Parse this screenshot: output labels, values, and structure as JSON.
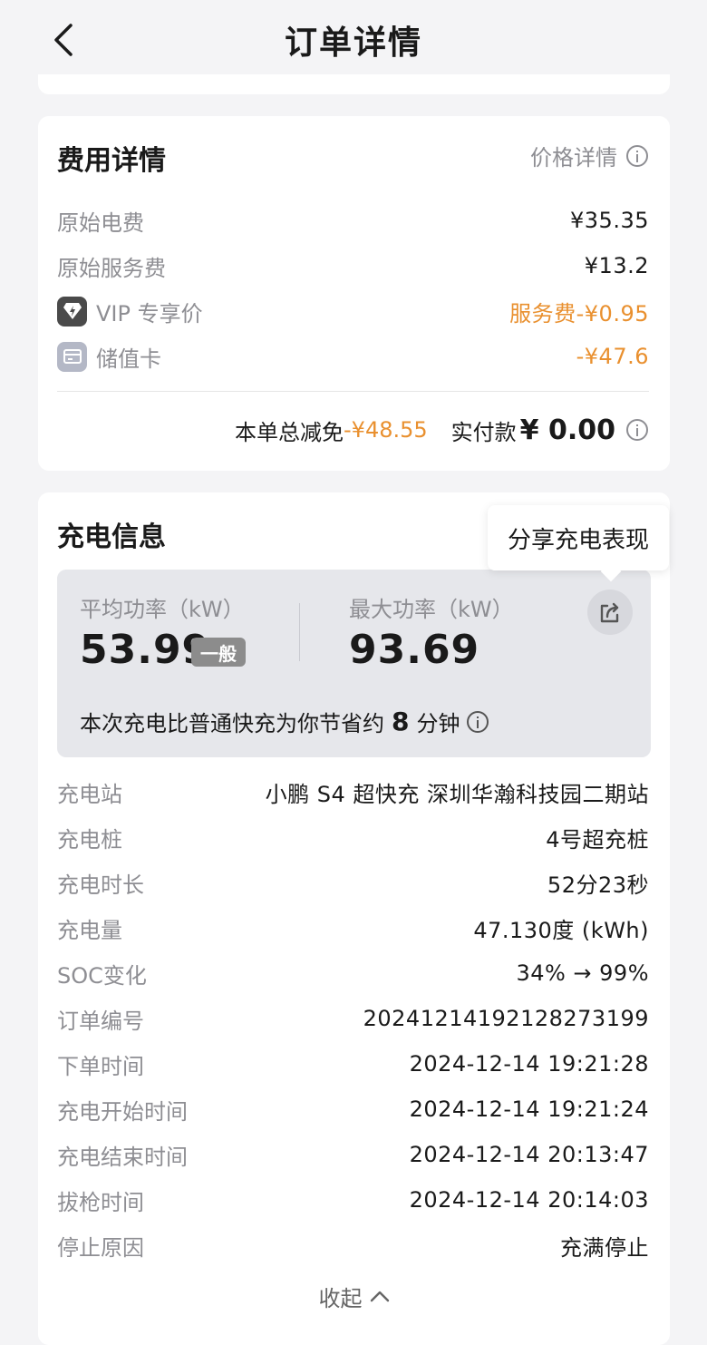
{
  "nav": {
    "title": "订单详情"
  },
  "fee": {
    "title": "费用详情",
    "price_detail_link": "价格详情",
    "rows": [
      {
        "label": "原始电费",
        "value": "¥35.35"
      },
      {
        "label": "原始服务费",
        "value": "¥13.2"
      },
      {
        "label": "VIP 专享价",
        "value": "服务费-¥0.95",
        "icon": "vip-diamond-icon",
        "accent": "#e9902f"
      },
      {
        "label": "储值卡",
        "value": "-¥47.6",
        "icon": "card-icon",
        "accent": "#e9902f"
      }
    ],
    "total_discount_label": "本单总减免",
    "total_discount_value": "-¥48.55",
    "paid_label": "实付款",
    "paid_value": "¥ 0.00"
  },
  "charge": {
    "title": "充电信息",
    "share_tooltip": "分享充电表现",
    "avg_power_label": "平均功率（kW）",
    "avg_power_value": "53.99",
    "avg_power_level": "一般",
    "max_power_label": "最大功率（kW）",
    "max_power_value": "93.69",
    "saving_prefix": "本次充电比普通快充为你节省约",
    "saving_minutes": "8",
    "saving_suffix": "分钟",
    "details": [
      {
        "label": "充电站",
        "value": "小鹏 S4 超快充 深圳华瀚科技园二期站"
      },
      {
        "label": "充电桩",
        "value": "4号超充桩"
      },
      {
        "label": "充电时长",
        "value": "52分23秒"
      },
      {
        "label": "充电量",
        "value": "47.130度 (kWh)"
      },
      {
        "label": "SOC变化",
        "value": "34% → 99%"
      },
      {
        "label": "订单编号",
        "value": "20241214192128273199"
      },
      {
        "label": "下单时间",
        "value": "2024-12-14 19:21:28"
      },
      {
        "label": "充电开始时间",
        "value": "2024-12-14 19:21:24"
      },
      {
        "label": "充电结束时间",
        "value": "2024-12-14 20:13:47"
      },
      {
        "label": "拔枪时间",
        "value": "2024-12-14 20:14:03"
      },
      {
        "label": "停止原因",
        "value": "充满停止"
      }
    ],
    "collapse_label": "收起"
  },
  "colors": {
    "accent_orange": "#e9902f",
    "muted_text": "#8e8e93",
    "stats_bg": "#e6e7eb"
  }
}
